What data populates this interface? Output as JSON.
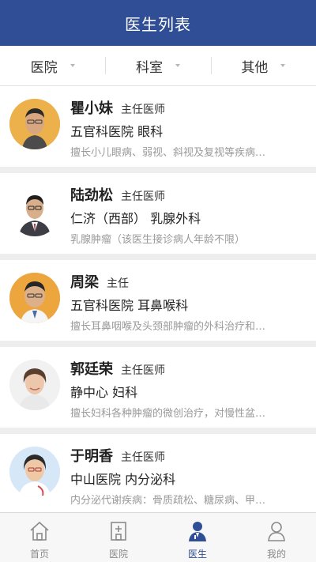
{
  "header": {
    "title": "医生列表"
  },
  "filters": [
    {
      "label": "医院"
    },
    {
      "label": "科室"
    },
    {
      "label": "其他"
    }
  ],
  "doctors": [
    {
      "name": "瞿小妹",
      "rank": "主任医师",
      "dept": "五官科医院 眼科",
      "desc": "擅长小儿眼病、弱视、斜视及复视等疾病…"
    },
    {
      "name": "陆劲松",
      "rank": "主任医师",
      "dept": "仁济（西部） 乳腺外科",
      "desc": "乳腺肿瘤（该医生接诊病人年龄不限）"
    },
    {
      "name": "周梁",
      "rank": "主任",
      "dept": "五官科医院 耳鼻喉科",
      "desc": "擅长耳鼻咽喉及头颈部肿瘤的外科治疗和…"
    },
    {
      "name": "郭廷荣",
      "rank": "主任医师",
      "dept": "静中心 妇科",
      "desc": "擅长妇科各种肿瘤的微创治疗，对慢性盆…"
    },
    {
      "name": "于明香",
      "rank": "主任医师",
      "dept": "中山医院 内分泌科",
      "desc": "内分泌代谢疾病：骨质疏松、糖尿病、甲…"
    }
  ],
  "tabbar": {
    "active": "医生",
    "items": [
      {
        "label": "首页",
        "icon": "home-icon"
      },
      {
        "label": "医院",
        "icon": "hospital-icon"
      },
      {
        "label": "医生",
        "icon": "doctor-icon"
      },
      {
        "label": "我的",
        "icon": "user-icon"
      }
    ]
  },
  "colors": {
    "primary": "#2f4e95",
    "inactive_tab": "#8a8a8a",
    "muted_text": "#9a9a9a"
  }
}
